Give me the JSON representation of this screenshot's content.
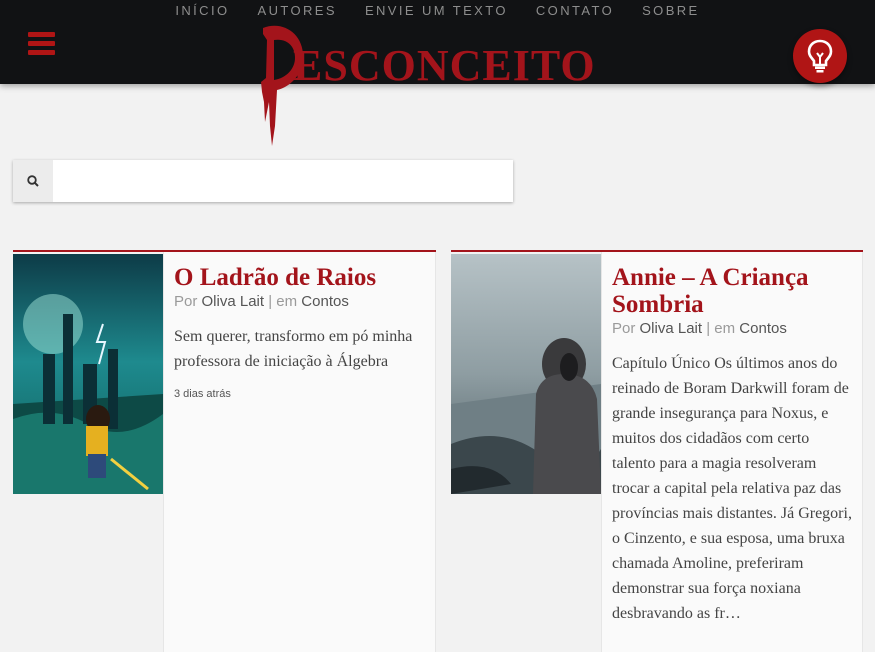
{
  "nav": [
    "INÍCIO",
    "AUTORES",
    "ENVIE UM TEXTO",
    "CONTATO",
    "SOBRE"
  ],
  "logo": {
    "text": "ESCONCEITO",
    "full_name": "DESCONCEITO"
  },
  "search": {
    "value": "",
    "placeholder": ""
  },
  "icons": {
    "menu": "hamburger-menu-icon",
    "idea": "lightbulb-icon",
    "search": "magnifier-icon"
  },
  "colors": {
    "accent": "#a3141b",
    "topbar": "#111214",
    "background": "#f2f2f2"
  },
  "posts": [
    {
      "title": "O Ladrão de Raios",
      "by": "Por",
      "author": "Oliva Lait",
      "in": "| em",
      "category": "Contos",
      "excerpt": "Sem querer, transformo em pó minha professora de iniciação à Álgebra",
      "date": "3 dias atrás"
    },
    {
      "title": "Annie – A Criança Sombria",
      "by": "Por",
      "author": "Oliva Lait",
      "in": "| em",
      "category": "Contos",
      "excerpt": "Capítulo Único Os últimos anos do reinado de Boram Darkwill foram de grande insegurança para Noxus, e muitos dos cidadãos com certo talento para a magia resolveram trocar a capital pela relativa paz das províncias mais distantes. Já Gregori, o Cinzento, e sua esposa, uma bruxa chamada Amoline, preferiram demonstrar sua força noxiana desbravando as fr…",
      "date": ""
    }
  ]
}
